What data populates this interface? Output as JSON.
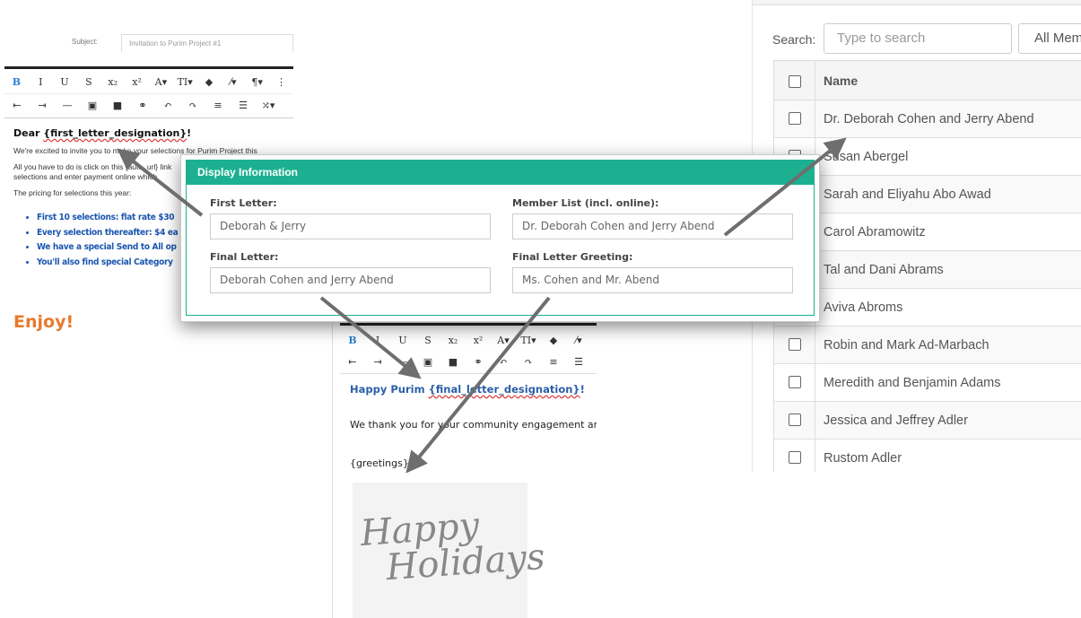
{
  "left_editor": {
    "subject_label": "Subject:",
    "subject_value": "Invitation to Purim Project #1",
    "toolbar_row1": [
      "B",
      "I",
      "U",
      "S",
      "x₂",
      "x²",
      "A▾",
      "TI▾",
      "◆",
      "⁄▾",
      "¶▾",
      "⋮"
    ],
    "toolbar_row2": [
      "⇤",
      "⇥",
      "—",
      "▣",
      "■",
      "⚭",
      "↶",
      "↷",
      "≡",
      "☰",
      "⤮▾"
    ],
    "greeting_prefix": "Dear ",
    "greeting_var": "{first_letter_designation}",
    "greeting_suffix": "!",
    "para1": "We're excited to invite you to make your selections for Purim Project this",
    "para2a": "All you have to do is click on this {auto_url} link",
    "para2b": "selections and enter payment online which",
    "para3": "The pricing for selections this year:",
    "bullets": [
      "First 10 selections: flat rate $30",
      "Every selection thereafter: $4 ea",
      "We have a special Send to All op",
      "You'll also find special Category"
    ],
    "enjoy": "Enjoy!"
  },
  "member_panel": {
    "search_label": "Search:",
    "search_placeholder": "Type to search",
    "filter_value": "All Mem",
    "column_name": "Name",
    "members": [
      "Dr. Deborah Cohen and Jerry Abend",
      "Susan Abergel",
      "Sarah and Eliyahu Abo Awad",
      "Carol Abramowitz",
      "Tal and Dani Abrams",
      "Aviva Abroms",
      "Robin and Mark Ad-Marbach",
      "Meredith and Benjamin Adams",
      "Jessica and Jeffrey Adler",
      "Rustom Adler"
    ]
  },
  "bottom_editor": {
    "toolbar_row1": [
      "B",
      "I",
      "U",
      "S",
      "x₂",
      "x²",
      "A▾",
      "TI▾",
      "◆",
      "⁄▾"
    ],
    "toolbar_row2": [
      "⇤",
      "⇥",
      "—",
      "▣",
      "■",
      "⚭",
      "↶",
      "↷",
      "≡",
      "☰"
    ],
    "happy_prefix": "Happy Purim ",
    "happy_var": "{final_letter_designation}",
    "happy_suffix": "!",
    "thank_line": "We thank you for your community engagement and",
    "greetings_var": "{greetings}",
    "image_line1": "Happy",
    "image_line2": "Holidays"
  },
  "modal": {
    "title": "Display Information",
    "first_letter_label": "First Letter:",
    "first_letter_value": "Deborah & Jerry",
    "member_list_label": "Member List (incl. online):",
    "member_list_value": "Dr. Deborah Cohen and Jerry Abend",
    "final_letter_label": "Final Letter:",
    "final_letter_value": "Deborah Cohen and Jerry Abend",
    "final_greeting_label": "Final Letter Greeting:",
    "final_greeting_value": "Ms. Cohen and Mr. Abend"
  },
  "colors": {
    "modal_header": "#1cb091",
    "bullet_blue": "#1a56b0",
    "enjoy_orange": "#e8792b",
    "arrow_gray": "#6e6e6e"
  }
}
